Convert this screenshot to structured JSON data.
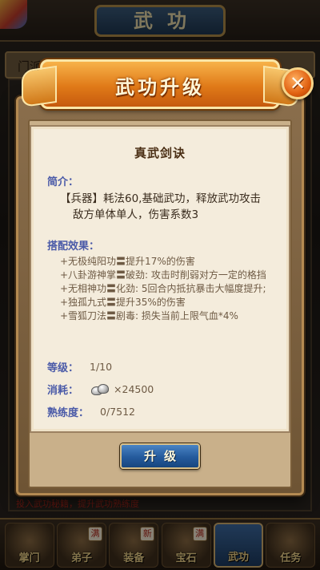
{
  "background": {
    "screen_title": "武功",
    "tab_label": "门派",
    "warning_text": "投入武功秘籍，提升武功熟练度",
    "bottom_nav": [
      {
        "label": "掌门",
        "badge": ""
      },
      {
        "label": "弟子",
        "badge": "满"
      },
      {
        "label": "装备",
        "badge": "新"
      },
      {
        "label": "宝石",
        "badge": "满"
      },
      {
        "label": "武功",
        "badge": ""
      },
      {
        "label": "任务",
        "badge": ""
      }
    ]
  },
  "dialog": {
    "title": "武功升级",
    "skill_name": "真武剑诀",
    "intro_label": "简介：",
    "intro_line1": "【兵器】耗法60,基础武功，释放武功攻击",
    "intro_line2": "敌方单体单人，伤害系数3",
    "combo_label": "搭配效果：",
    "combo_effects": [
      "+无极纯阳功〓提升17%的伤害",
      "+八卦游神掌〓破劲: 攻击时削弱对方一定的格挡",
      "+无相神功〓化劲: 5回合内抵抗暴击大幅度提升;",
      "+独孤九式〓提升35%的伤害",
      "+雪狐刀法〓剧毒: 损失当前上限气血*4%"
    ],
    "level_label": "等级：",
    "level_value": "1/10",
    "cost_label": "消耗：",
    "cost_value": "×24500",
    "cost_icon": "silver-ingot-icon",
    "proficiency_label": "熟练度：",
    "proficiency_value": "0/7512",
    "upgrade_label": "升级"
  }
}
